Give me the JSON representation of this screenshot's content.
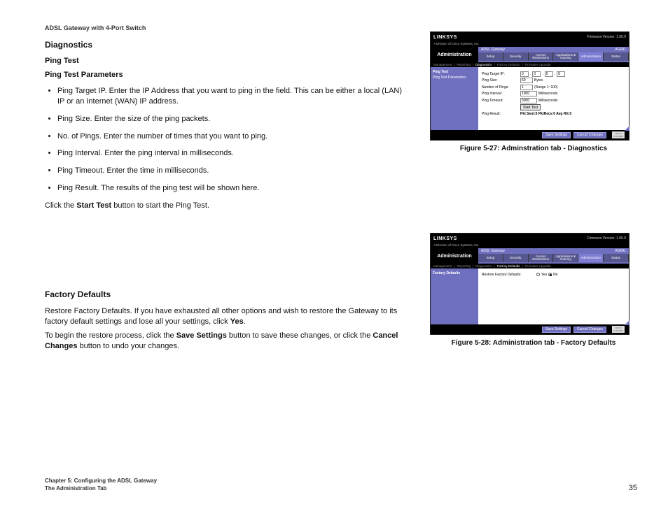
{
  "header": {
    "product": "ADSL Gateway with 4-Port Switch"
  },
  "diag": {
    "title": "Diagnostics",
    "sub1": "Ping Test",
    "sub2": "Ping Test Parameters",
    "bullets": [
      "Ping Target IP. Enter the IP Address that you want to ping in the field. This can be either a local (LAN) IP or an Internet (WAN) IP address.",
      "Ping Size. Enter the size of the ping packets.",
      "No. of Pings. Enter the number of times that you want to ping.",
      "Ping Interval. Enter the ping interval in milliseconds.",
      "Ping Timeout. Enter the time in milliseconds.",
      "Ping Result. The results of the ping test will be shown here."
    ],
    "after_a": "Click the ",
    "after_b": "Start Test",
    "after_c": " button to start the Ping Test."
  },
  "factory": {
    "title": "Factory Defaults",
    "p1_a": "Restore Factory Defaults. If you have exhausted all other options and wish to restore the Gateway to its factory default settings and lose all your settings, click ",
    "p1_b": "Yes",
    "p1_c": ".",
    "p2_a": "To begin the restore process, click the ",
    "p2_b": "Save Settings",
    "p2_c": " button to save these changes, or click the ",
    "p2_d": "Cancel Changes",
    "p2_e": " button to undo your changes."
  },
  "fig1": {
    "caption": "Figure 5-27: Adminstration tab - Diagnostics"
  },
  "fig2": {
    "caption": "Figure 5-28: Administration tab - Factory Defaults"
  },
  "panel_common": {
    "logo": "LINKSYS",
    "division": "A Division of Cisco Systems, Inc.",
    "firmware": "Firmware Version: 1.00.0",
    "gateway": "ADSL Gateway",
    "model": "AG041",
    "admin": "Administration",
    "tabs": [
      "Setup",
      "Security",
      "Access Restrictions",
      "Applications & Gaming",
      "Administration",
      "Status"
    ],
    "save": "Save Settings",
    "cancel": "Cancel Changes",
    "cisco": "CISCO SYSTEMS"
  },
  "panel1": {
    "subnav": [
      "Management",
      "Reporting",
      "Diagnostics",
      "Factory Defaults",
      "Firmware Upgrade"
    ],
    "subnav_active": "Diagnostics",
    "side_title": "Ping Test",
    "side_sub": "Ping Test Parameters",
    "rows": {
      "target_k": "Ping Target IP:",
      "target_v1": "0",
      "target_v2": "0",
      "target_v3": "0",
      "target_v4": "0",
      "size_k": "Ping Size:",
      "size_v": "60",
      "size_u": "Bytes",
      "num_k": "Number of Pings:",
      "num_v": "1",
      "num_u": "(Range 1~100)",
      "int_k": "Ping Interval:",
      "int_v": "1000",
      "int_u": "Milliseconds",
      "to_k": "Ping Timeout:",
      "to_v": "5000",
      "to_u": "Milliseconds",
      "start": "Start Test",
      "result_k": "Ping Result:",
      "result_v": "Pkt Sent:0 PktRecv:0 Avg Rtt:0"
    }
  },
  "panel2": {
    "subnav": [
      "Management",
      "Reporting",
      "Diagnostics",
      "Factory Defaults",
      "Firmware Upgrade"
    ],
    "subnav_active": "Factory Defaults",
    "side_title": "Factory Defaults",
    "row_k": "Restore Factory Defaults:",
    "yes": "Yes",
    "no": "No"
  },
  "footer": {
    "chapter": "Chapter 5: Configuring the ADSL Gateway",
    "section": "The Administration Tab",
    "page": "35"
  }
}
